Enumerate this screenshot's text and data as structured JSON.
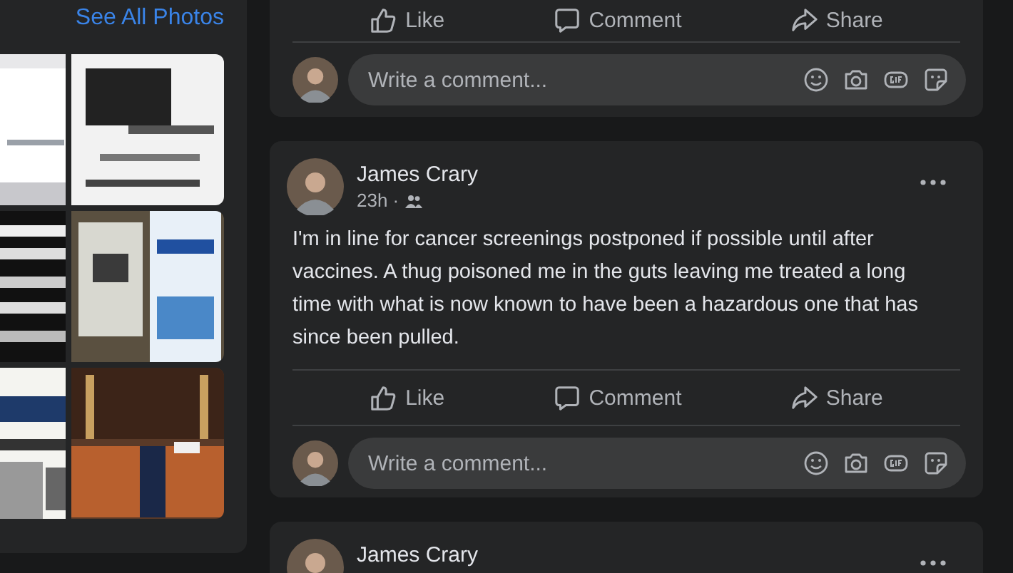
{
  "photos_panel": {
    "link": "See All Photos"
  },
  "posts": [
    {
      "actions": [
        {
          "kind": "like",
          "label": "Like"
        },
        {
          "kind": "comment",
          "label": "Comment"
        },
        {
          "kind": "share",
          "label": "Share"
        }
      ],
      "comment_placeholder": "Write a comment..."
    },
    {
      "author": "James Crary",
      "time": "23h ·",
      "text": "I'm in line for cancer screenings postponed if possible until after vaccines.  A thug poisoned me in the guts leaving me treated a long time with what is now known to have been a hazardous one that has since been pulled.",
      "actions": [
        {
          "kind": "like",
          "label": "Like"
        },
        {
          "kind": "comment",
          "label": "Comment"
        },
        {
          "kind": "share",
          "label": "Share"
        }
      ],
      "comment_placeholder": "Write a comment..."
    },
    {
      "author": "James Crary"
    }
  ]
}
